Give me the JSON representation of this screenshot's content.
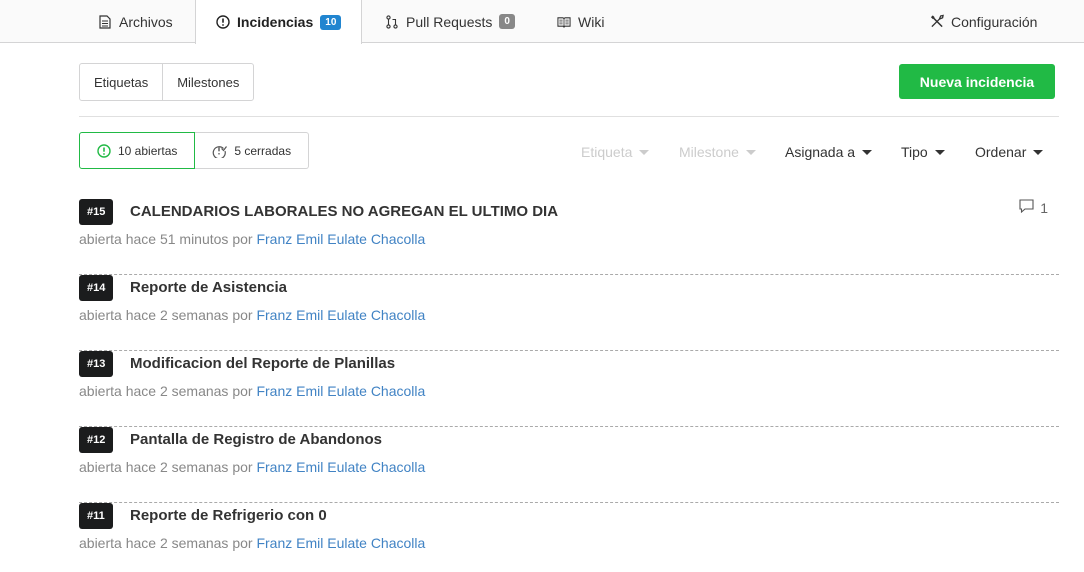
{
  "tabs": [
    {
      "label": "Archivos",
      "icon": "file-text-icon"
    },
    {
      "label": "Incidencias",
      "icon": "issue-opened-icon",
      "badge": "10",
      "badge_color": "#2185d0"
    },
    {
      "label": "Pull Requests",
      "icon": "git-pull-request-icon",
      "badge": "0",
      "badge_color": "#888888"
    },
    {
      "label": "Wiki",
      "icon": "book-icon"
    }
  ],
  "settings_label": "Configuración",
  "label_button": "Etiquetas",
  "milestones_button": "Milestones",
  "new_issue_button": "Nueva incidencia",
  "open_state": "10 abiertas",
  "closed_state": "5 cerradas",
  "filters": {
    "label": "Etiqueta",
    "milestone": "Milestone",
    "assignee": "Asignada a",
    "type": "Tipo",
    "sort": "Ordenar"
  },
  "colors": {
    "accent": "#21ba45",
    "link": "#4183c4",
    "badge_blue": "#2185d0"
  },
  "issues": [
    {
      "number": "#15",
      "title": "CALENDARIOS LABORALES NO AGREGAN EL ULTIMO DIA",
      "meta_prefix": "abierta hace 51 minutos por",
      "author": "Franz Emil Eulate Chacolla",
      "comments": "1"
    },
    {
      "number": "#14",
      "title": "Reporte de Asistencia",
      "meta_prefix": "abierta hace 2 semanas por",
      "author": "Franz Emil Eulate Chacolla"
    },
    {
      "number": "#13",
      "title": "Modificacion del Reporte de Planillas",
      "meta_prefix": "abierta hace 2 semanas por",
      "author": "Franz Emil Eulate Chacolla"
    },
    {
      "number": "#12",
      "title": "Pantalla de Registro de Abandonos",
      "meta_prefix": "abierta hace 2 semanas por",
      "author": "Franz Emil Eulate Chacolla"
    },
    {
      "number": "#11",
      "title": "Reporte de Refrigerio con 0",
      "meta_prefix": "abierta hace 2 semanas por",
      "author": "Franz Emil Eulate Chacolla"
    }
  ]
}
